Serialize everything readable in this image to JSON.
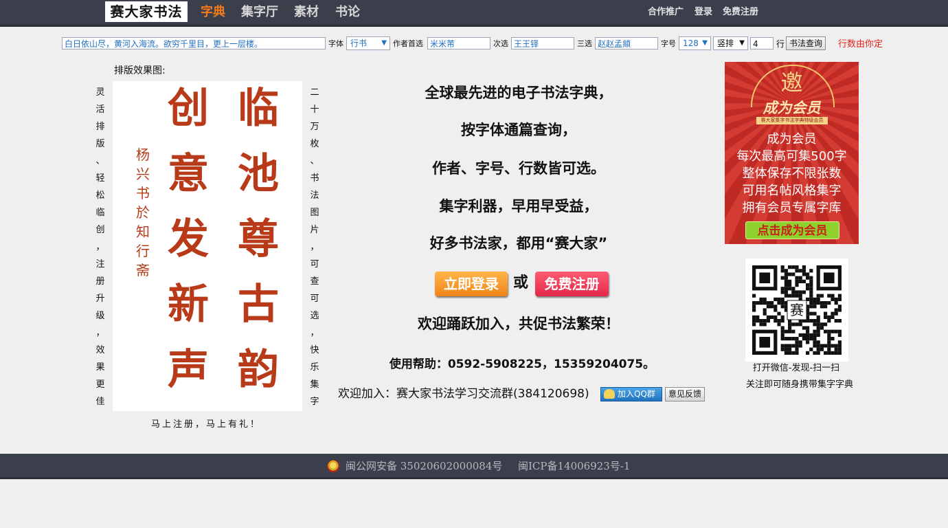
{
  "header": {
    "logo_text": "赛大家书法",
    "nav": [
      "字典",
      "集字厅",
      "素材",
      "书论"
    ],
    "links": [
      "合作推广",
      "登录",
      "免费注册"
    ]
  },
  "search": {
    "text_value": "白日依山尽，黄河入海流。欲穷千里目，更上一层楼。",
    "font_label": "字体",
    "font_value": "行书",
    "author1_label": "作者首选",
    "author1_value": "米米芾",
    "author2_label": "次选",
    "author2_value": "王王铎",
    "author3_label": "三选",
    "author3_value": "赵赵孟頫",
    "size_label": "字号",
    "size_value": "128",
    "layout_value": "竖排",
    "rows_value": "4",
    "rows_label": "行",
    "query_button": "书法查询",
    "hint": "行数由你定"
  },
  "preview": {
    "title": "排版效果图:",
    "left_vertical": [
      "灵",
      "活",
      "排",
      "版",
      "、",
      "轻",
      "松",
      "临",
      "创",
      "，",
      "注",
      "册",
      "升",
      "级",
      "，",
      "效",
      "果",
      "更",
      "佳"
    ],
    "right_vertical": [
      "二",
      "十",
      "万",
      "枚",
      "、",
      "书",
      "法",
      "图",
      "片",
      "，",
      "可",
      "查",
      "可",
      "选",
      "，",
      "快",
      "乐",
      "集",
      "字"
    ],
    "col_right": [
      "临",
      "池",
      "尊",
      "古",
      "韵"
    ],
    "col_left": [
      "创",
      "意",
      "发",
      "新",
      "声"
    ],
    "signature": [
      "杨",
      "兴",
      "书",
      "於",
      "知",
      "行",
      "斋"
    ],
    "bottom_note": "马上注册，马上有礼！"
  },
  "center": {
    "lines": [
      "全球最先进的电子书法字典，",
      "按字体通篇查询，",
      "作者、字号、行数皆可选。",
      "集字利器，早用早受益，",
      "好多书法家，都用“赛大家”"
    ],
    "login_button": "立即登录",
    "or_text": "或",
    "register_button": "免费注册",
    "welcome": "欢迎踊跃加入，共促书法繁荣！",
    "help": "使用帮助：0592-5908225，15359204075。",
    "group": "欢迎加入：赛大家书法学习交流群(384120698)",
    "qq_button": "加入QQ群",
    "feedback_button": "意见反馈"
  },
  "ad": {
    "invite": "邀",
    "become": "成为会员",
    "tiny": "赛大家集字书法字典特级会员",
    "lines": [
      "成为会员",
      "每次最高可集500字",
      "整体保存不限张数",
      "可用名帖风格集字",
      "拥有会员专属字库"
    ],
    "cta": "点击成为会员"
  },
  "qr": {
    "center_char": "赛",
    "caption1": "打开微信-发现-扫一扫",
    "caption2": "关注即可随身携带集字字典"
  },
  "footer": {
    "police": "闽公网安备 35020602000084号",
    "icp": "闽ICP备14006923号-1"
  }
}
